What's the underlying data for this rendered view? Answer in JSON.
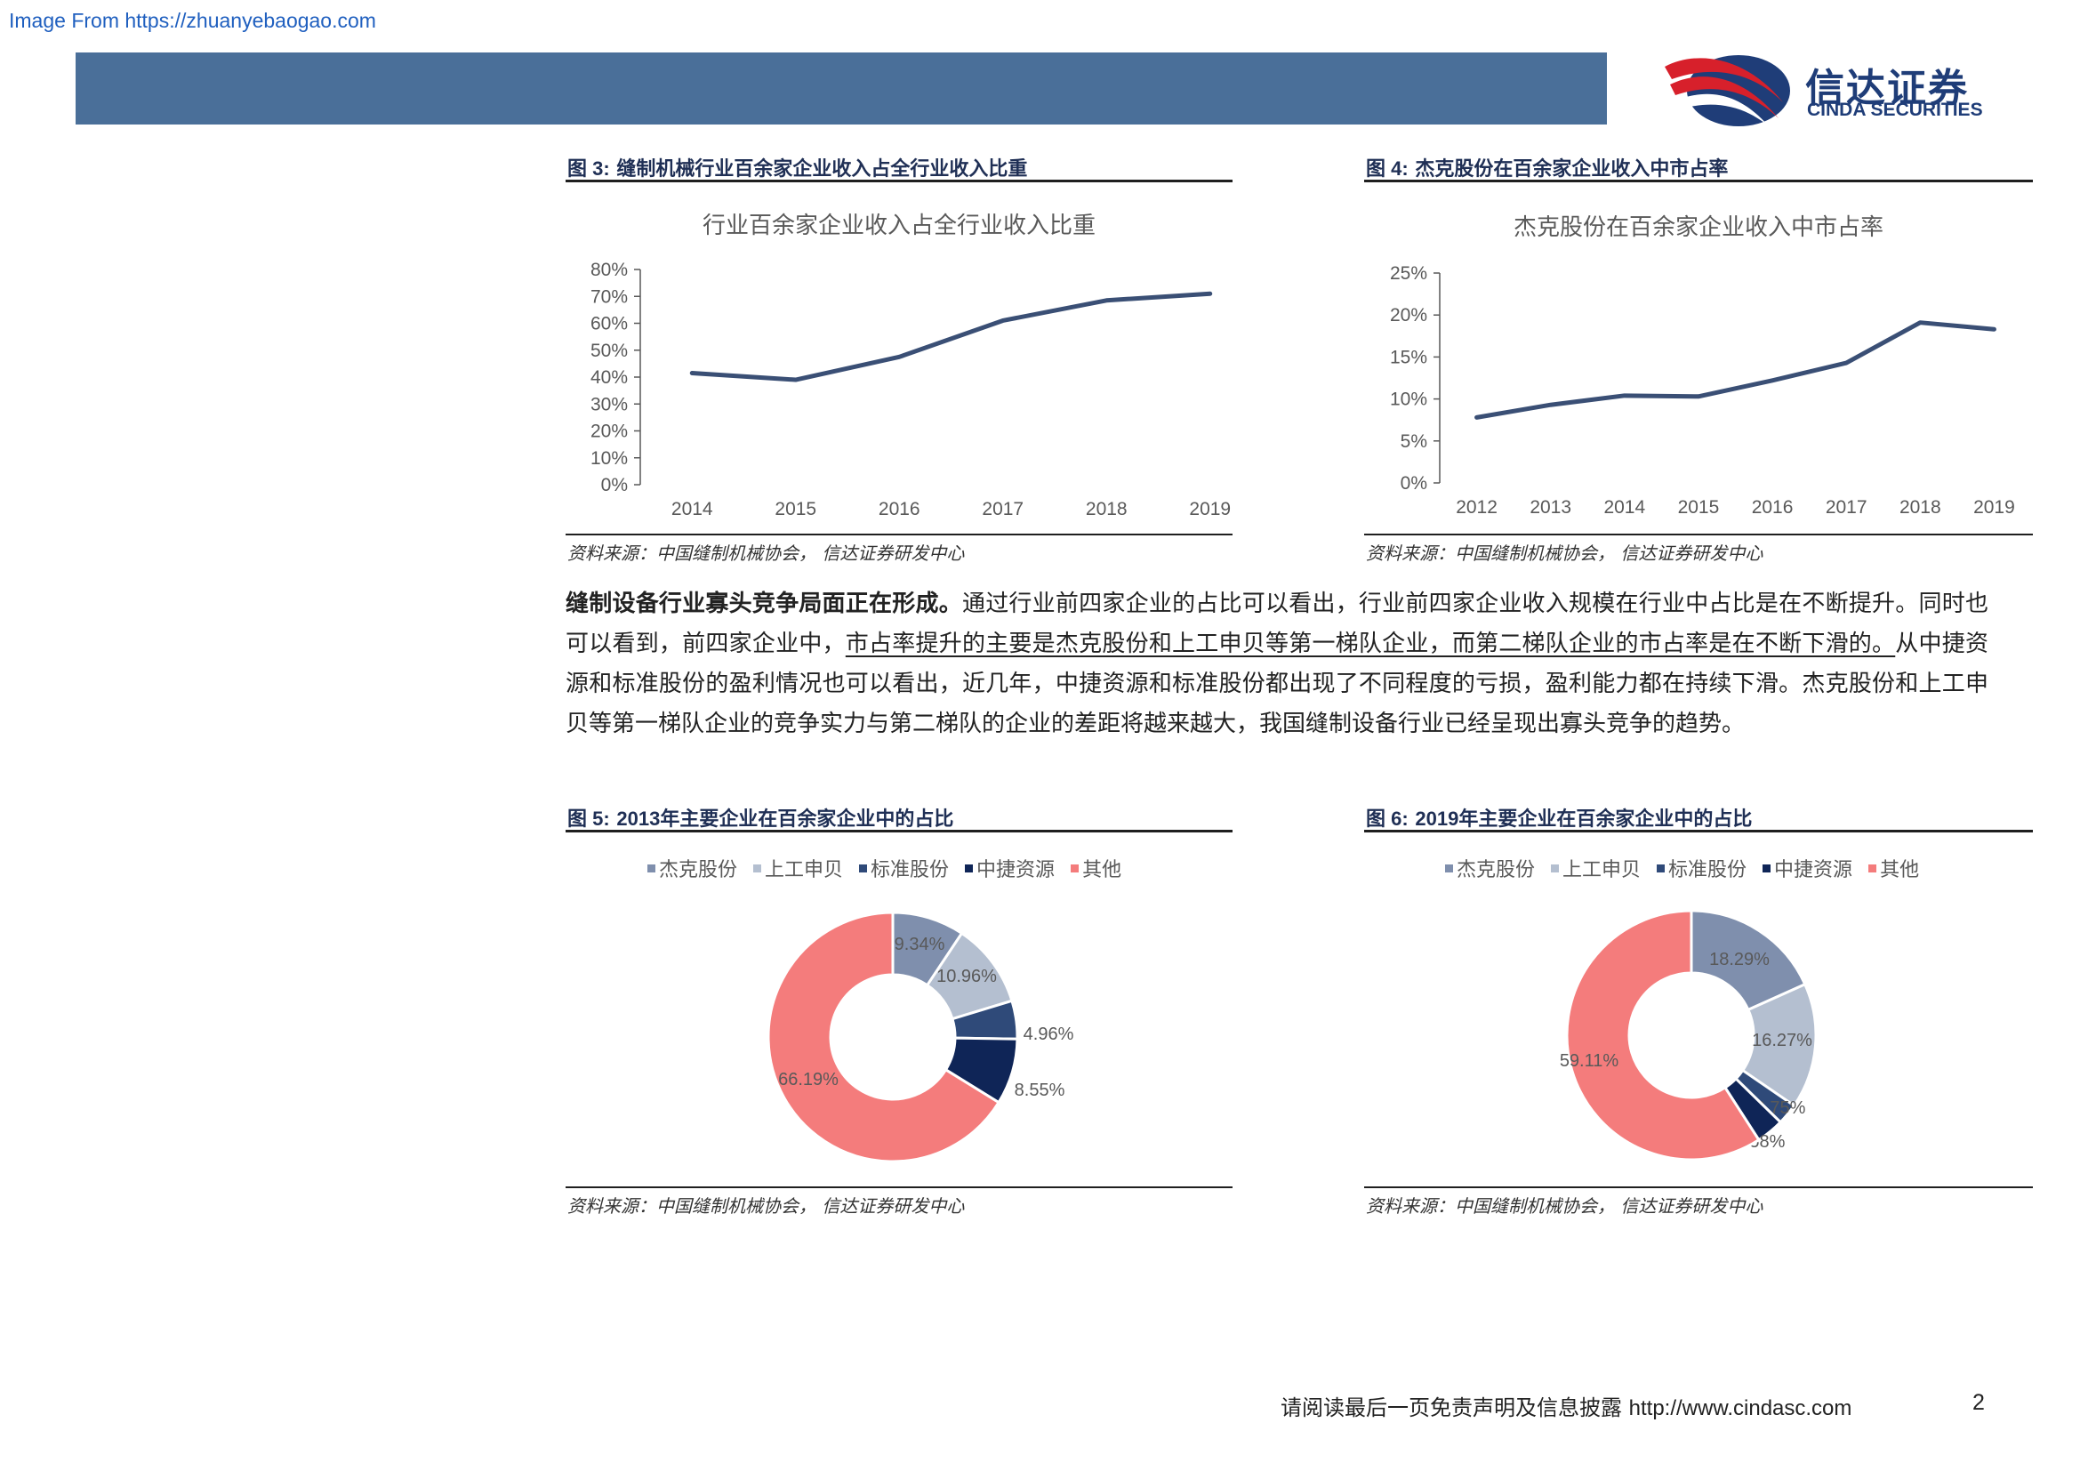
{
  "watermark": "Image From https://zhuanyebaogao.com",
  "logo": {
    "cn": "信达证券",
    "en": "CINDA SECURITIES",
    "icon": "cinda-swoosh-logo"
  },
  "colors": {
    "banner": "#4a6f99",
    "line": "#3a4f75",
    "s1": "#7f8fad",
    "s2": "#b4bfd0",
    "s3": "#2f4a79",
    "s4": "#0f2557",
    "s5": "#f47c7c"
  },
  "fig3": {
    "label": "图 3:",
    "title": "缝制机械行业百余家企业收入占全行业收入比重",
    "source": "资料来源：中国缝制机械协会，  信达证券研发中心",
    "chart_data": {
      "type": "line",
      "title": "行业百余家企业收入占全行业收入比重",
      "categories": [
        "2014",
        "2015",
        "2016",
        "2017",
        "2018",
        "2019"
      ],
      "values": [
        41.5,
        39,
        47.5,
        61,
        68.5,
        71
      ],
      "yticks": [
        "0%",
        "10%",
        "20%",
        "30%",
        "40%",
        "50%",
        "60%",
        "70%",
        "80%"
      ],
      "ylim": [
        0,
        80
      ]
    }
  },
  "fig4": {
    "label": "图 4:",
    "title": "杰克股份在百余家企业收入中市占率",
    "source": "资料来源：中国缝制机械协会，  信达证券研发中心",
    "chart_data": {
      "type": "line",
      "title": "杰克股份在百余家企业收入中市占率",
      "categories": [
        "2012",
        "2013",
        "2014",
        "2015",
        "2016",
        "2017",
        "2018",
        "2019"
      ],
      "values": [
        7.8,
        9.3,
        10.4,
        10.3,
        12.2,
        14.3,
        19.1,
        18.3
      ],
      "yticks": [
        "0%",
        "5%",
        "10%",
        "15%",
        "20%",
        "25%"
      ],
      "ylim": [
        0,
        25
      ]
    }
  },
  "paragraph": {
    "lead": "缝制设备行业寡头竞争局面正在形成。",
    "part1": "通过行业前四家企业的占比可以看出，行业前四家企业收入规模在行业中占比是在不断提升。同时也可以看到，前四家企业中，",
    "underlined": "市占率提升的主要是杰克股份和上工申贝等第一梯队企业，而第二梯队企业的市占率是在不断下滑的。",
    "part2": "从中捷资源和标准股份的盈利情况也可以看出，近几年，中捷资源和标准股份都出现了不同程度的亏损，盈利能力都在持续下滑。杰克股份和上工申贝等第一梯队企业的竞争实力与第二梯队的企业的差距将越来越大，我国缝制设备行业已经呈现出寡头竞争的趋势。"
  },
  "fig5": {
    "label": "图 5:",
    "title_year": "2013",
    "title": "年主要企业在百余家企业中的占比",
    "source": "资料来源：中国缝制机械协会，  信达证券研发中心",
    "chart_data": {
      "type": "pie",
      "categories": [
        "杰克股份",
        "上工申贝",
        "标准股份",
        "中捷资源",
        "其他"
      ],
      "values": [
        9.34,
        10.96,
        4.96,
        8.55,
        66.19
      ],
      "labels": [
        "9.34%",
        "10.96%",
        "4.96%",
        "8.55%",
        "66.19%"
      ]
    }
  },
  "fig6": {
    "label": "图 6:",
    "title_year": "2019",
    "title": "年主要企业在百余家企业中的占比",
    "source": "资料来源：中国缝制机械协会，  信达证券研发中心",
    "chart_data": {
      "type": "pie",
      "categories": [
        "杰克股份",
        "上工申贝",
        "标准股份",
        "中捷资源",
        "其他"
      ],
      "values": [
        18.29,
        16.27,
        2.75,
        3.58,
        59.11
      ],
      "labels": [
        "18.29%",
        "16.27%",
        "2.75%",
        "3.58%",
        "59.11%"
      ]
    }
  },
  "footer": {
    "text": "请阅读最后一页免责声明及信息披露",
    "url": "http://www.cindasc.com",
    "page": "2"
  }
}
